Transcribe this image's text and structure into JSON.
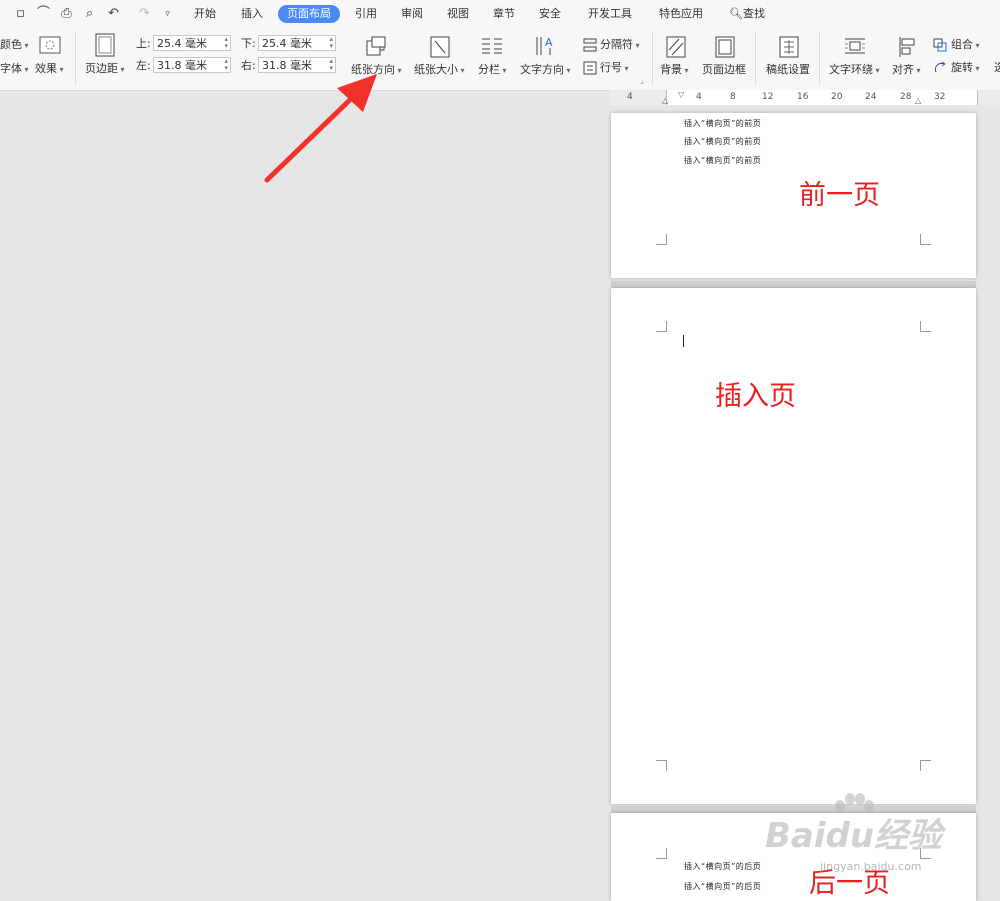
{
  "tabs": [
    "开始",
    "插入",
    "页面布局",
    "引用",
    "审阅",
    "视图",
    "章节",
    "安全",
    "开发工具",
    "特色应用"
  ],
  "active_tab": "页面布局",
  "search_label": "查找",
  "ribbon": {
    "color_label": "颜色",
    "font_label": "字体",
    "effects_label": "效果",
    "margins_label": "页边距",
    "top_label": "上:",
    "top_value": "25.4 毫米",
    "bottom_label": "下:",
    "bottom_value": "25.4 毫米",
    "left_label": "左:",
    "left_value": "31.8 毫米",
    "right_label": "右:",
    "right_value": "31.8 毫米",
    "orientation_label": "纸张方向",
    "size_label": "纸张大小",
    "columns_label": "分栏",
    "text_direction_label": "文字方向",
    "breaks_label": "分隔符",
    "line_numbers_label": "行号",
    "background_label": "背景",
    "page_border_label": "页面边框",
    "manuscript_label": "稿纸设置",
    "text_wrap_label": "文字环绕",
    "align_label": "对齐",
    "group_label": "组合",
    "rotate_label": "旋转"
  },
  "ruler_ticks": [
    "4",
    "4",
    "8",
    "12",
    "16",
    "20",
    "24",
    "28",
    "32"
  ],
  "pages": {
    "prev_lines": [
      "插入“横向页”的前页",
      "插入“横向页”的前页",
      "插入“横向页”的前页"
    ],
    "prev_caption": "前一页",
    "insert_caption": "插入页",
    "next_lines": [
      "插入“横向页”的后页",
      "插入“横向页”的后页"
    ],
    "next_caption": "后一页"
  },
  "watermark": "Baidu经验",
  "watermark_sub": "jingyan.baidu.com",
  "colors": {
    "accent": "#4a8af4",
    "annotation_red": "#e8211e"
  }
}
